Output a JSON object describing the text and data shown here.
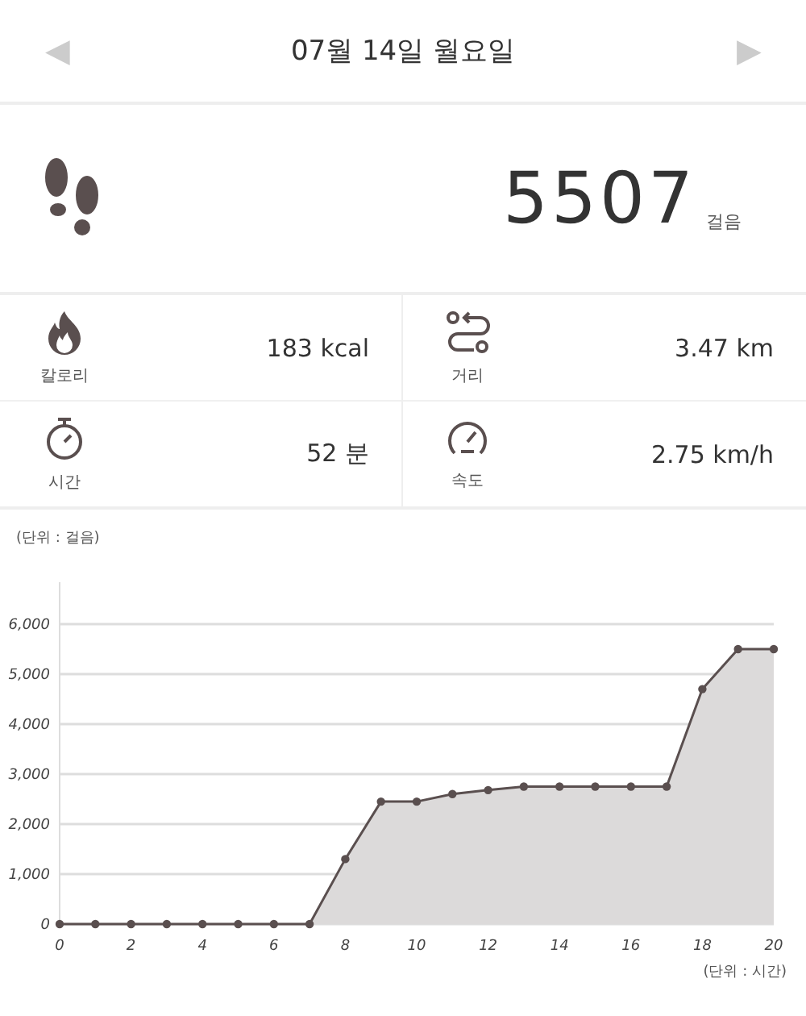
{
  "header": {
    "date": "07월 14일 월요일",
    "prev": "◀",
    "next": "▶"
  },
  "steps": {
    "value": "5507",
    "unit": "걸음"
  },
  "stats": [
    {
      "kind": "calorie",
      "label": "칼로리",
      "value": "183 kcal"
    },
    {
      "kind": "distance",
      "label": "거리",
      "value": "3.47 km"
    },
    {
      "kind": "time",
      "label": "시간",
      "value": "52 분"
    },
    {
      "kind": "speed",
      "label": "속도",
      "value": "2.75 km/h"
    }
  ],
  "chart": {
    "chart_data": {
      "type": "area",
      "ylabel": "(단위 : 걸음)",
      "xlabel": "(단위 : 시간)",
      "x": [
        0,
        1,
        2,
        3,
        4,
        5,
        6,
        7,
        8,
        9,
        10,
        11,
        12,
        13,
        14,
        15,
        16,
        17,
        18,
        19,
        20
      ],
      "grid": true,
      "series": [
        {
          "color": "#5a4f4f",
          "values": [
            0,
            0,
            0,
            0,
            0,
            0,
            0,
            0,
            1300,
            2450,
            2450,
            2600,
            2680,
            2750,
            2750,
            2750,
            2750,
            2750,
            4700,
            5500,
            5500
          ]
        }
      ],
      "xlim": [
        0,
        20
      ],
      "ylim": [
        0,
        6000
      ],
      "xticks": [
        {
          "value": 0,
          "label": "0"
        },
        {
          "value": 2,
          "label": "2"
        },
        {
          "value": 4,
          "label": "4"
        },
        {
          "value": 6,
          "label": "6"
        },
        {
          "value": 8,
          "label": "8"
        },
        {
          "value": 10,
          "label": "10"
        },
        {
          "value": 12,
          "label": "12"
        },
        {
          "value": 14,
          "label": "14"
        },
        {
          "value": 16,
          "label": "16"
        },
        {
          "value": 18,
          "label": "18"
        },
        {
          "value": 20,
          "label": "20"
        }
      ],
      "yticks": [
        {
          "value": 0,
          "label": "0"
        },
        {
          "value": 1000,
          "label": "1,000"
        },
        {
          "value": 2000,
          "label": "2,000"
        },
        {
          "value": 3000,
          "label": "3,000"
        },
        {
          "value": 4000,
          "label": "4,000"
        },
        {
          "value": 5000,
          "label": "5,000"
        },
        {
          "value": 6000,
          "label": "6,000"
        }
      ]
    }
  }
}
